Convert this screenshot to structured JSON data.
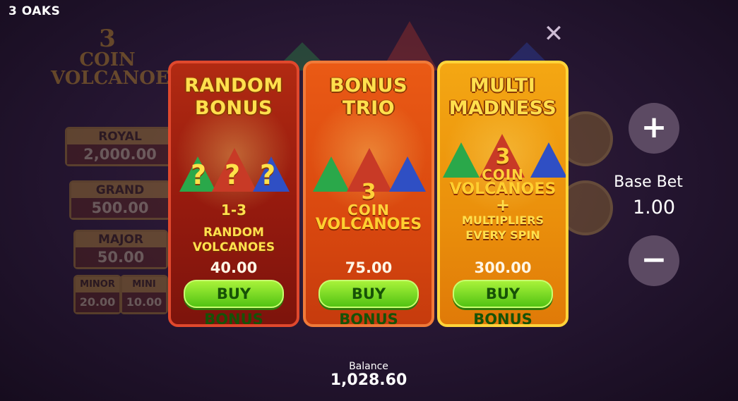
{
  "brand": "3 OAKS",
  "background_game": {
    "logo": {
      "number": "3",
      "word1": "COIN",
      "word2": "VOLCANOES"
    },
    "jackpots": [
      {
        "label": "ROYAL",
        "value": "2,000.00"
      },
      {
        "label": "GRAND",
        "value": "500.00"
      },
      {
        "label": "MAJOR",
        "value": "50.00"
      },
      {
        "label": "MINOR",
        "value": "20.00"
      },
      {
        "label": "MINI",
        "value": "10.00"
      }
    ]
  },
  "close_icon": "close-icon",
  "cards": [
    {
      "title1": "RANDOM",
      "title2": "BONUS",
      "line1": "1-3",
      "line2": "RANDOM",
      "line3": "VOLCANOES",
      "price": "40.00",
      "button": "BUY BONUS"
    },
    {
      "title1": "BONUS",
      "title2": "TRIO",
      "logo_number": "3",
      "logo_word1": "COIN",
      "logo_word2": "VOLCANOES",
      "price": "75.00",
      "button": "BUY BONUS"
    },
    {
      "title1": "MULTI",
      "title2": "MADNESS",
      "logo_number": "3",
      "logo_word1": "COIN",
      "logo_word2": "VOLCANOES",
      "plus": "+",
      "line1": "MULTIPLIERS",
      "line2": "EVERY SPIN",
      "price": "300.00",
      "button": "BUY BONUS"
    }
  ],
  "controls": {
    "plus": "+",
    "minus": "−",
    "base_bet_label": "Base Bet",
    "base_bet_value": "1.00"
  },
  "balance": {
    "label": "Balance",
    "value": "1,028.60"
  },
  "colors": {
    "card1": "#951a0e",
    "card2": "#d9480f",
    "card3": "#ea8f0b",
    "buy_button": "#52c313",
    "title_gold": "#ffe04d"
  }
}
